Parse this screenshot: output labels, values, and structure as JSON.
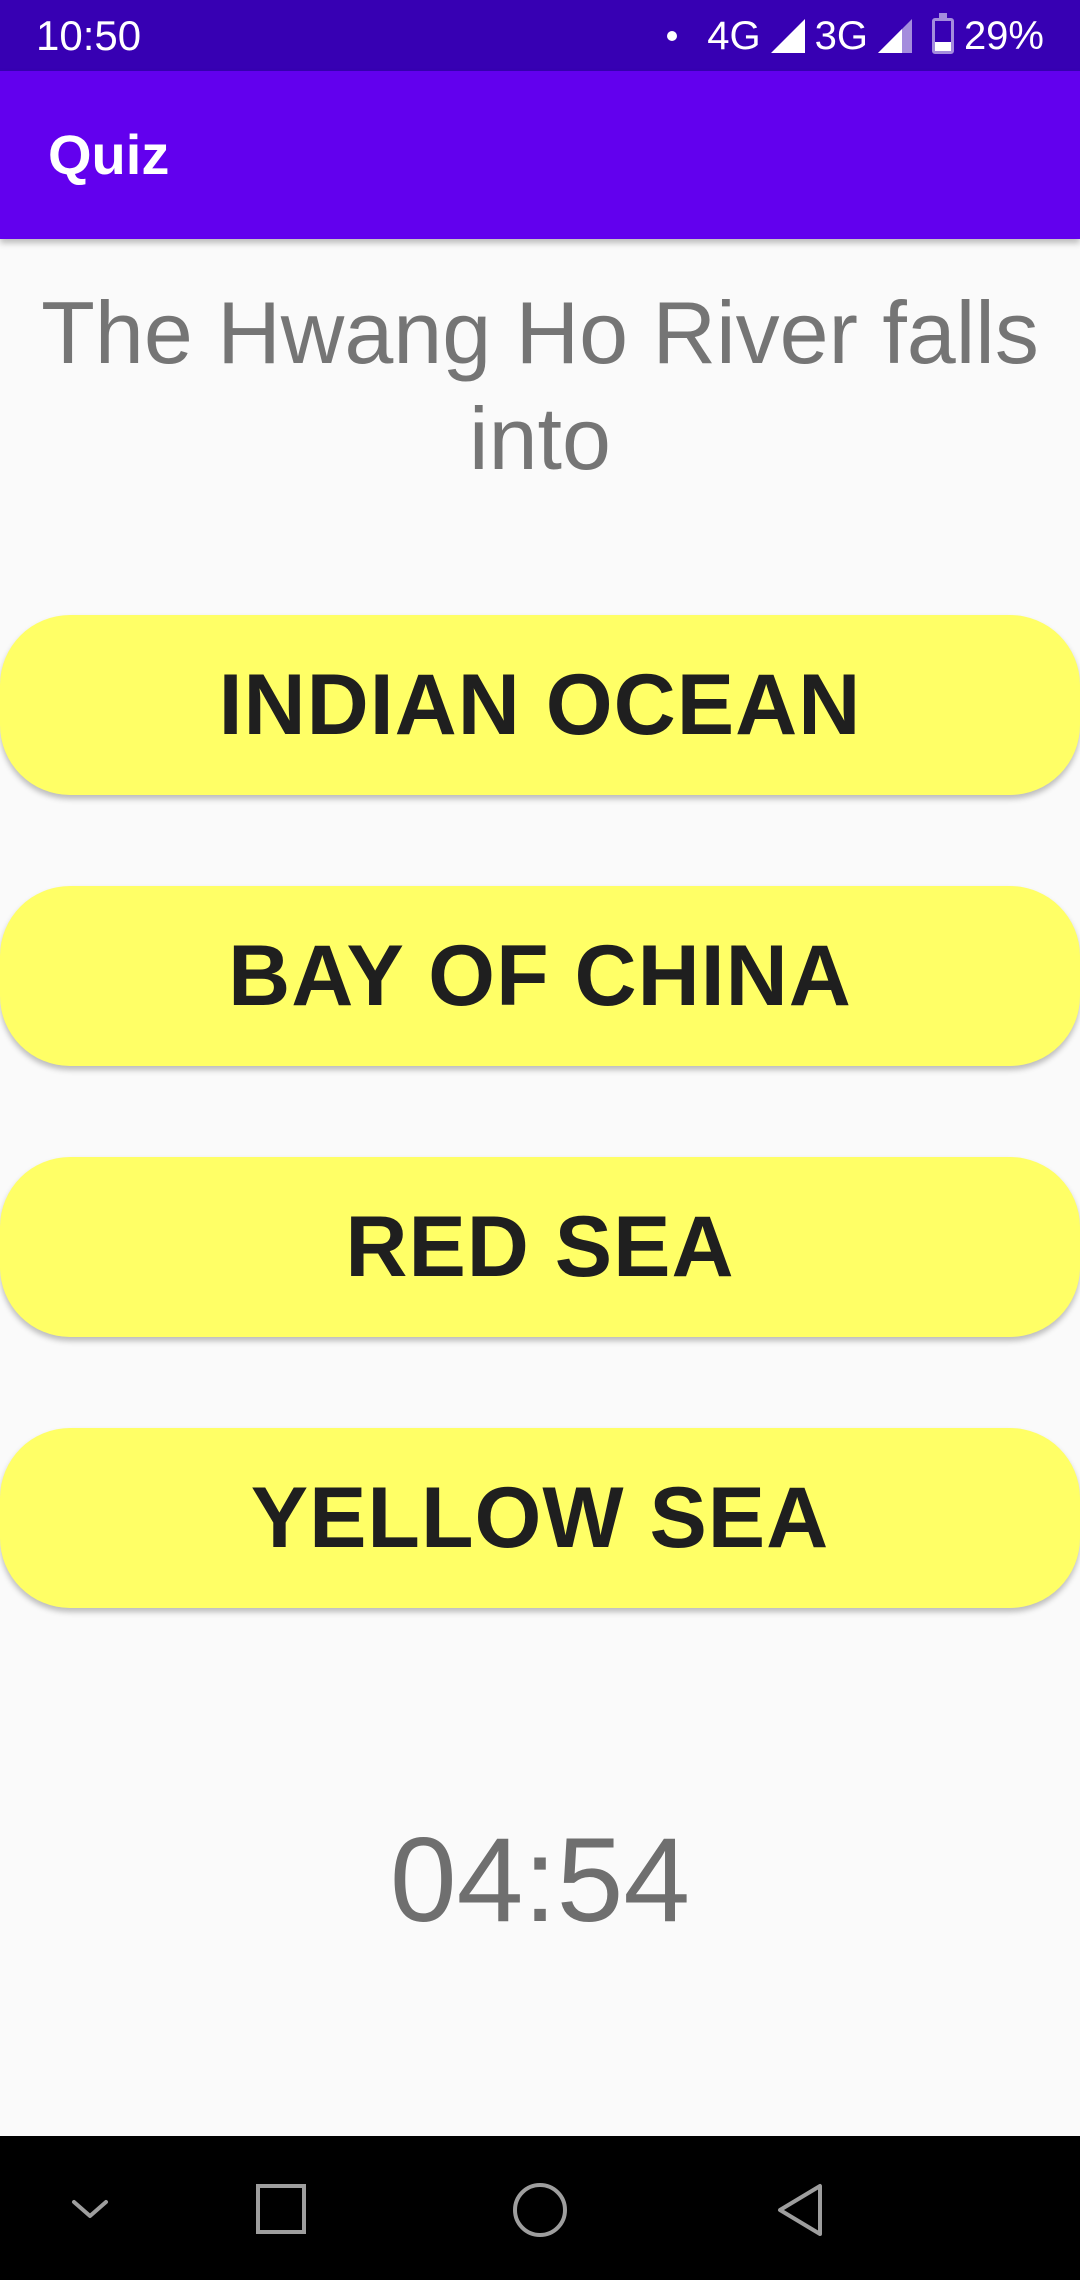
{
  "status_bar": {
    "time": "10:50",
    "network_1": "4G",
    "network_2": "3G",
    "battery": "29%",
    "battery_level": 0.29
  },
  "app_bar": {
    "title": "Quiz"
  },
  "question": {
    "text": "The Hwang Ho River falls into"
  },
  "answers": [
    {
      "label": "INDIAN OCEAN"
    },
    {
      "label": "BAY OF CHINA"
    },
    {
      "label": "RED SEA"
    },
    {
      "label": "YELLOW SEA"
    }
  ],
  "timer": {
    "value": "04:54"
  },
  "nav_bar": {
    "icons": [
      "chevron-down-icon",
      "recents-square-icon",
      "home-circle-icon",
      "back-triangle-icon"
    ]
  },
  "colors": {
    "status_bar": "#3700b3",
    "app_bar": "#6200ee",
    "answer_button": "#ffff66",
    "background": "#fafafa"
  }
}
